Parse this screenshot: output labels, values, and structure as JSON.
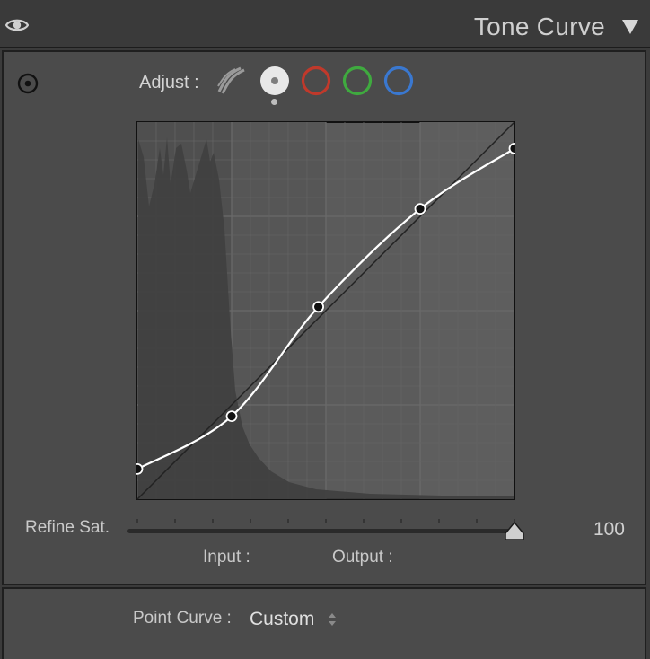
{
  "header": {
    "title": "Tone Curve"
  },
  "adjust": {
    "label": "Adjust :",
    "channels": [
      {
        "name": "parametric",
        "color": "#9a9a9a"
      },
      {
        "name": "point-rgb",
        "color": "#e8e8e8",
        "selected": true
      },
      {
        "name": "red",
        "color": "#c0392b"
      },
      {
        "name": "green",
        "color": "#3faa3f"
      },
      {
        "name": "blue",
        "color": "#3a78d0"
      }
    ]
  },
  "curve": {
    "points": [
      [
        0,
        0.08
      ],
      [
        0.25,
        0.22
      ],
      [
        0.48,
        0.51
      ],
      [
        0.75,
        0.77
      ],
      [
        1.0,
        0.93
      ]
    ]
  },
  "refine": {
    "label": "Refine Sat.",
    "value": "100",
    "fraction": 1.0
  },
  "io": {
    "input_label": "Input :",
    "output_label": "Output :"
  },
  "point_curve": {
    "label": "Point Curve :",
    "value": "Custom"
  }
}
